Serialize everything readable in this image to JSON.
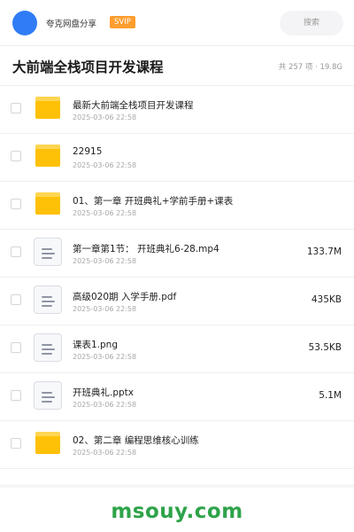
{
  "header": {
    "share_name": "夸克网盘分享",
    "badge": "SVIP",
    "search": {
      "placeholder": "搜索"
    }
  },
  "title": "大前端全栈项目开发课程",
  "summary": "共 257 项 · 19.8G",
  "files": [
    {
      "type": "folder",
      "icon": "folder-icon",
      "name": "最新大前端全栈项目开发课程",
      "date": "2025-03-06 22:58",
      "size": ""
    },
    {
      "type": "folder",
      "icon": "folder-icon",
      "name": "22915",
      "date": "2025-03-06 22:58",
      "size": ""
    },
    {
      "type": "folder",
      "icon": "folder-icon",
      "name": "01、第一章 开班典礼+学前手册+课表",
      "date": "2025-03-06 22:58",
      "size": ""
    },
    {
      "type": "file",
      "icon": "document-icon",
      "name": "第一章第1节： 开班典礼6-28.mp4",
      "date": "2025-03-06 22:58",
      "size": "133.7M"
    },
    {
      "type": "file",
      "icon": "document-icon",
      "name": "高级020期 入学手册.pdf",
      "date": "2025-03-06 22:58",
      "size": "435KB"
    },
    {
      "type": "file",
      "icon": "document-icon",
      "name": "课表1.png",
      "date": "2025-03-06 22:58",
      "size": "53.5KB"
    },
    {
      "type": "file",
      "icon": "document-icon",
      "name": "开班典礼.pptx",
      "date": "2025-03-06 22:58",
      "size": "5.1M"
    },
    {
      "type": "folder",
      "icon": "folder-icon",
      "name": "02、第二章 编程思维核心训练",
      "date": "2025-03-06 22:58",
      "size": ""
    }
  ],
  "watermark": "msouy.com",
  "colors": {
    "avatar": "#2f7cf6",
    "svip_badge": "#ff9d2e",
    "folder": "#ffc107",
    "watermark": "#2ea34a"
  }
}
